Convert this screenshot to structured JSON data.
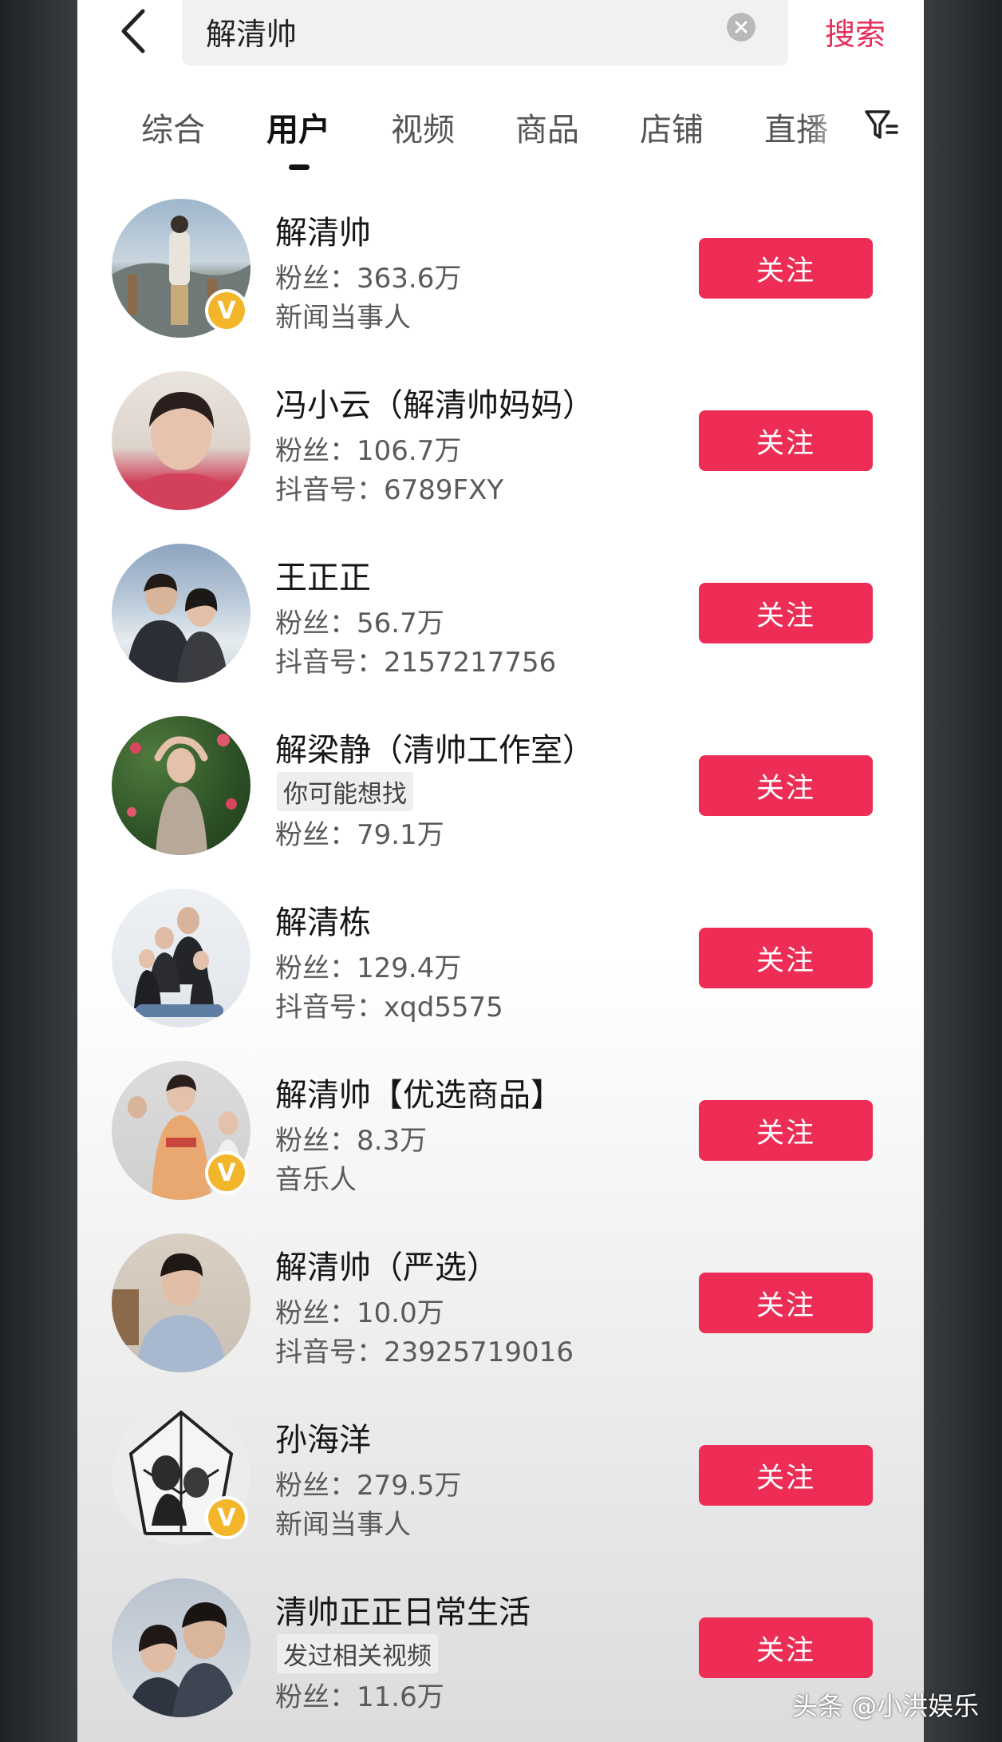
{
  "search": {
    "query": "解清帅",
    "submit_label": "搜索"
  },
  "tabs": [
    {
      "label": "综合"
    },
    {
      "label": "用户"
    },
    {
      "label": "视频"
    },
    {
      "label": "商品"
    },
    {
      "label": "店铺"
    },
    {
      "label": "直播"
    }
  ],
  "active_tab": "用户",
  "users": [
    {
      "name": "解清帅",
      "line1": "粉丝：363.6万",
      "line2": "新闻当事人",
      "verified": true,
      "follow_label": "关注"
    },
    {
      "name": "冯小云（解清帅妈妈）",
      "line1": "粉丝：106.7万",
      "line2": "抖音号：6789FXY",
      "verified": false,
      "follow_label": "关注"
    },
    {
      "name": "王正正",
      "line1": "粉丝：56.7万",
      "line2": "抖音号：2157217756",
      "verified": false,
      "follow_label": "关注"
    },
    {
      "name": "解梁静（清帅工作室）",
      "tag": "你可能想找",
      "line2": "粉丝：79.1万",
      "verified": false,
      "follow_label": "关注"
    },
    {
      "name": "解清栋",
      "line1": "粉丝：129.4万",
      "line2": "抖音号：xqd5575",
      "verified": false,
      "follow_label": "关注"
    },
    {
      "name": "解清帅【优选商品】",
      "line1": "粉丝：8.3万",
      "line2": "音乐人",
      "verified": true,
      "follow_label": "关注"
    },
    {
      "name": "解清帅（严选）",
      "line1": "粉丝：10.0万",
      "line2": "抖音号：23925719016",
      "verified": false,
      "follow_label": "关注"
    },
    {
      "name": "孙海洋",
      "line1": "粉丝：279.5万",
      "line2": "新闻当事人",
      "verified": true,
      "follow_label": "关注"
    },
    {
      "name": "清帅正正日常生活",
      "tag": "发过相关视频",
      "line2": "粉丝：11.6万",
      "verified": false,
      "follow_label": "关注"
    }
  ],
  "verified_badge_letter": "V",
  "watermark": "头条 @小洪娱乐",
  "colors": {
    "accent": "#ed2d55",
    "search_submit": "#e52d5a",
    "badge": "#f3b52a"
  },
  "icons": [
    "back-arrow-icon",
    "clear-icon",
    "filter-icon",
    "verified-v-icon"
  ]
}
